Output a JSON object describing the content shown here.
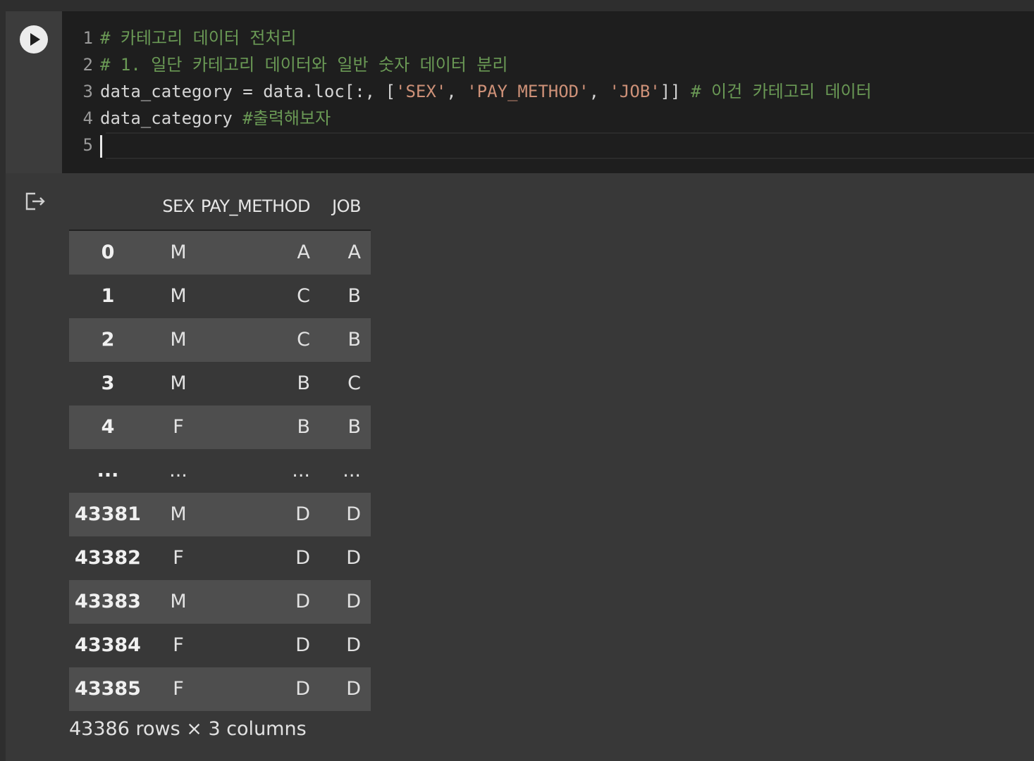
{
  "cell": {
    "run_button_label": "Run cell",
    "code_lines": [
      {
        "num": "1",
        "tokens": [
          {
            "t": "# 카테고리 데이터 전처리",
            "k": "comment"
          }
        ]
      },
      {
        "num": "2",
        "tokens": [
          {
            "t": "# 1. 일단 카테고리 데이터와 일반 숫자 데이터 분리",
            "k": "comment"
          }
        ]
      },
      {
        "num": "3",
        "tokens": [
          {
            "t": "data_category = data.loc[:, [",
            "k": "plain"
          },
          {
            "t": "'SEX'",
            "k": "string"
          },
          {
            "t": ", ",
            "k": "plain"
          },
          {
            "t": "'PAY_METHOD'",
            "k": "string"
          },
          {
            "t": ", ",
            "k": "plain"
          },
          {
            "t": "'JOB'",
            "k": "string"
          },
          {
            "t": "]] ",
            "k": "plain"
          },
          {
            "t": "# 이건 카테고리 데이터",
            "k": "comment"
          }
        ]
      },
      {
        "num": "4",
        "tokens": [
          {
            "t": "data_category ",
            "k": "plain"
          },
          {
            "t": "#출력해보자",
            "k": "comment"
          }
        ]
      },
      {
        "num": "5",
        "tokens": []
      }
    ]
  },
  "output": {
    "icon": "output-redirect-icon",
    "columns": [
      "SEX",
      "PAY_METHOD",
      "JOB"
    ],
    "rows": [
      {
        "index": "0",
        "SEX": "M",
        "PAY_METHOD": "A",
        "JOB": "A"
      },
      {
        "index": "1",
        "SEX": "M",
        "PAY_METHOD": "C",
        "JOB": "B"
      },
      {
        "index": "2",
        "SEX": "M",
        "PAY_METHOD": "C",
        "JOB": "B"
      },
      {
        "index": "3",
        "SEX": "M",
        "PAY_METHOD": "B",
        "JOB": "C"
      },
      {
        "index": "4",
        "SEX": "F",
        "PAY_METHOD": "B",
        "JOB": "B"
      },
      {
        "index": "...",
        "SEX": "...",
        "PAY_METHOD": "...",
        "JOB": "..."
      },
      {
        "index": "43381",
        "SEX": "M",
        "PAY_METHOD": "D",
        "JOB": "D"
      },
      {
        "index": "43382",
        "SEX": "F",
        "PAY_METHOD": "D",
        "JOB": "D"
      },
      {
        "index": "43383",
        "SEX": "M",
        "PAY_METHOD": "D",
        "JOB": "D"
      },
      {
        "index": "43384",
        "SEX": "F",
        "PAY_METHOD": "D",
        "JOB": "D"
      },
      {
        "index": "43385",
        "SEX": "F",
        "PAY_METHOD": "D",
        "JOB": "D"
      }
    ],
    "shape_caption": "43386 rows × 3 columns"
  },
  "colors": {
    "background": "#383838",
    "editor_background": "#1e1e1e",
    "comment": "#6a9955",
    "string": "#ce9178",
    "row_shade": "#4e4e4e"
  }
}
